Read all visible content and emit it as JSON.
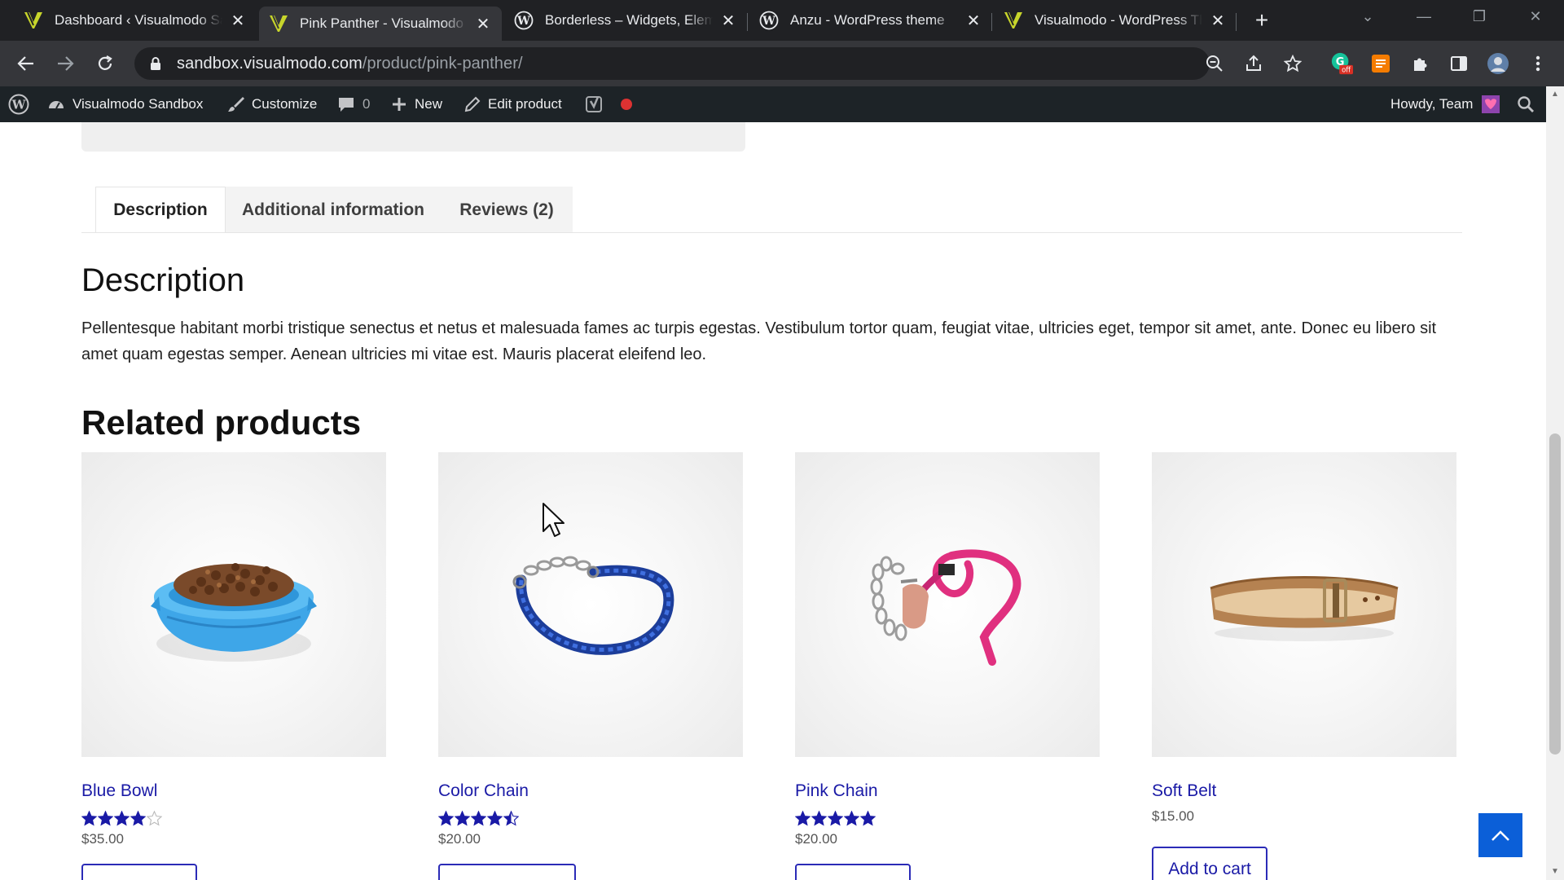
{
  "browser": {
    "tabs": [
      {
        "title": "Dashboard ‹ Visualmodo Sandbox",
        "icon": "visualmodo-icon"
      },
      {
        "title": "Pink Panther - Visualmodo Sandbox",
        "icon": "visualmodo-icon"
      },
      {
        "title": "Borderless – Widgets, Elements",
        "icon": "wordpress-icon"
      },
      {
        "title": "Anzu - WordPress theme",
        "icon": "wordpress-icon"
      },
      {
        "title": "Visualmodo - WordPress Themes",
        "icon": "visualmodo-icon"
      }
    ],
    "url_host": "sandbox.visualmodo.com",
    "url_path": "/product/pink-panther/",
    "extension_badge": "off"
  },
  "adminbar": {
    "site_name": "Visualmodo Sandbox",
    "customize": "Customize",
    "comments_count": "0",
    "new": "New",
    "edit_product": "Edit product",
    "howdy": "Howdy, Team"
  },
  "product_tabs": [
    {
      "label": "Description"
    },
    {
      "label": "Additional information"
    },
    {
      "label": "Reviews (2)"
    }
  ],
  "description": {
    "heading": "Description",
    "text": "Pellentesque habitant morbi tristique senectus et netus et malesuada fames ac turpis egestas. Vestibulum tortor quam, feugiat vitae, ultricies eget, tempor sit amet, ante. Donec eu libero sit amet quam egestas semper. Aenean ultricies mi vitae est. Mauris placerat eleifend leo."
  },
  "related": {
    "heading": "Related products",
    "products": [
      {
        "name": "Blue Bowl",
        "rating": 4.0,
        "price": "$35.00"
      },
      {
        "name": "Color Chain",
        "rating": 4.5,
        "price": "$20.00"
      },
      {
        "name": "Pink Chain",
        "rating": 5.0,
        "price": "$20.00"
      },
      {
        "name": "Soft Belt",
        "rating": null,
        "price": "$15.00",
        "button": "Add to cart"
      }
    ]
  },
  "colors": {
    "link": "#1a1aa6",
    "star": "#1a1aa6",
    "scroll_top": "#0b5fd8",
    "adminbar": "#1d2327"
  }
}
